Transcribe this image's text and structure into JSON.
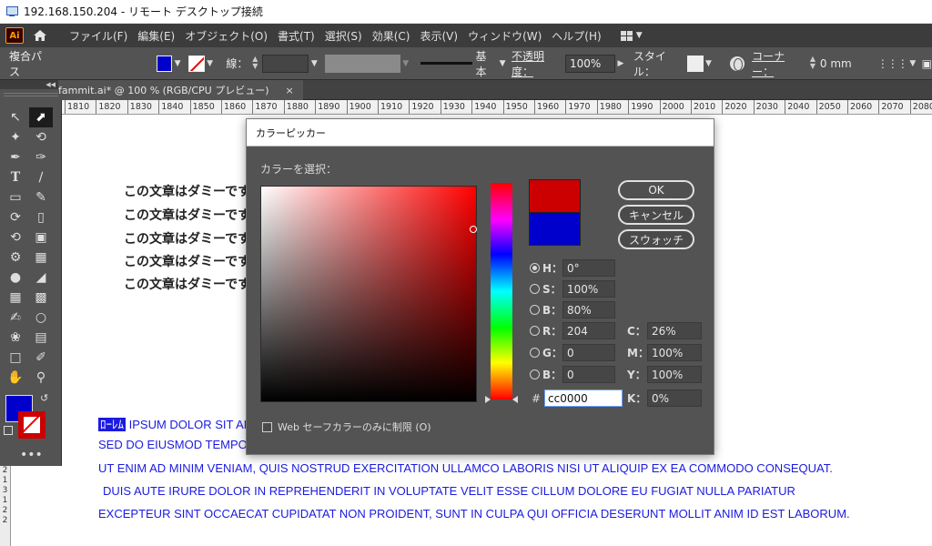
{
  "remote_window": {
    "title": "192.168.150.204 - リモート デスクトップ接続"
  },
  "app": {
    "logo": "Ai"
  },
  "menu": {
    "items": [
      "ファイル(F)",
      "編集(E)",
      "オブジェクト(O)",
      "書式(T)",
      "選択(S)",
      "効果(C)",
      "表示(V)",
      "ウィンドウ(W)",
      "ヘルプ(H)"
    ]
  },
  "control_bar": {
    "label": "複合パス",
    "stroke_label": "線：",
    "stroke_profile": "基本",
    "opacity_label": "不透明度：",
    "opacity_value": "100%",
    "style_label": "スタイル：",
    "corner_label": "コーナー：",
    "corner_value": "0 mm",
    "fill_color": "#0000cc"
  },
  "doc_tab": {
    "title": "fammit.ai* @ 100 % (RGB/CPU プレビュー)",
    "close": "×"
  },
  "ruler": {
    "ticks": [
      "1810",
      "1820",
      "1830",
      "1840",
      "1850",
      "1860",
      "1870",
      "1880",
      "1890",
      "1900",
      "1910",
      "1920",
      "1930",
      "1940",
      "1950",
      "1960",
      "1970",
      "1980",
      "1990",
      "2000",
      "2010",
      "2020",
      "2030",
      "2040",
      "2050",
      "2060",
      "2070",
      "2080"
    ]
  },
  "vertical_ruler": {
    "ticks": [
      "2",
      "1",
      "3",
      "1",
      "2",
      "2"
    ]
  },
  "canvas": {
    "jp_lines": [
      "この文章はダミーです",
      "この文章はダミーです",
      "この文章はダミーです",
      "この文章はダミーです",
      "この文章はダミーです"
    ],
    "selected_mark": "ﾛｰﾚﾑ",
    "blue_lines": [
      "IPSUM DOLOR SIT AMET, CONSECTETUR ADIPISCING ELIT,",
      "SED DO EIUSMOD TEMPOR INCIDIDUNT UT LABORE ET DOLORE MAGNA ALIQUA.",
      "UT ENIM AD MINIM VENIAM, QUIS NOSTRUD EXERCITATION ULLAMCO LABORIS NISI UT ALIQUIP EX EA COMMODO CONSEQUAT.",
      "DUIS AUTE IRURE DOLOR IN REPREHENDERIT IN VOLUPTATE VELIT ESSE CILLUM DOLORE EU FUGIAT NULLA PARIATUR",
      "EXCEPTEUR SINT OCCAECAT CUPIDATAT NON PROIDENT, SUNT IN CULPA QUI OFFICIA DESERUNT MOLLIT ANIM ID EST LABORUM."
    ],
    "text_color": "#1b1be0"
  },
  "color_picker": {
    "title": "カラーピッカー",
    "select_label": "カラーを選択：",
    "new_color": "#cc0000",
    "old_color": "#0000cc",
    "buttons": {
      "ok": "OK",
      "cancel": "キャンセル",
      "swatches": "スウォッチ"
    },
    "hsb": {
      "h_label": "H：",
      "h": "0°",
      "s_label": "S：",
      "s": "100%",
      "b_label": "B：",
      "b": "80%"
    },
    "rgb": {
      "r_label": "R：",
      "r": "204",
      "g_label": "G：",
      "g": "0",
      "b_label": "B：",
      "b": "0"
    },
    "cmyk": {
      "c_label": "C：",
      "c": "26%",
      "m_label": "M：",
      "m": "100%",
      "y_label": "Y：",
      "y": "100%",
      "k_label": "K：",
      "k": "0%"
    },
    "hex_label": "#",
    "hex": "cc0000",
    "web_only_label": "Web セーフカラーのみに制限 (O)"
  }
}
